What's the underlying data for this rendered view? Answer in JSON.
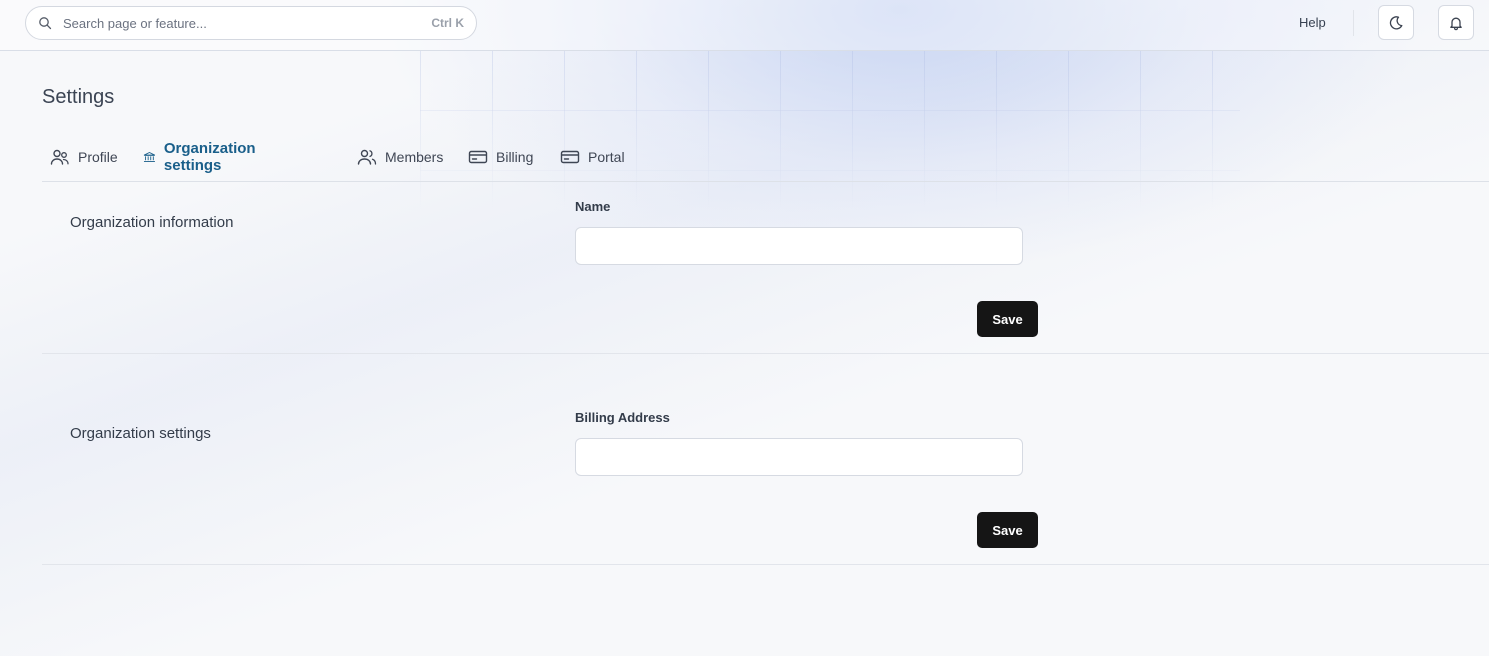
{
  "topbar": {
    "search_placeholder": "Search page or feature...",
    "search_shortcut": "Ctrl K",
    "help_label": "Help"
  },
  "page": {
    "title": "Settings"
  },
  "tabs": [
    {
      "label": "Profile",
      "icon": "users-icon",
      "active": false
    },
    {
      "label": "Organization settings",
      "icon": "bank-icon",
      "active": true
    },
    {
      "label": "Members",
      "icon": "members-icon",
      "active": false
    },
    {
      "label": "Billing",
      "icon": "credit-card-icon",
      "active": false
    },
    {
      "label": "Portal",
      "icon": "credit-card-icon",
      "active": false
    }
  ],
  "sections": [
    {
      "title": "Organization information",
      "field_label": "Name",
      "field_value": "",
      "save_label": "Save"
    },
    {
      "title": "Organization settings",
      "field_label": "Billing Address",
      "field_value": "",
      "save_label": "Save"
    }
  ],
  "colors": {
    "active_tab": "#1a5f8a",
    "save_button_bg": "#151515",
    "page_bg": "#f7f8fa"
  }
}
